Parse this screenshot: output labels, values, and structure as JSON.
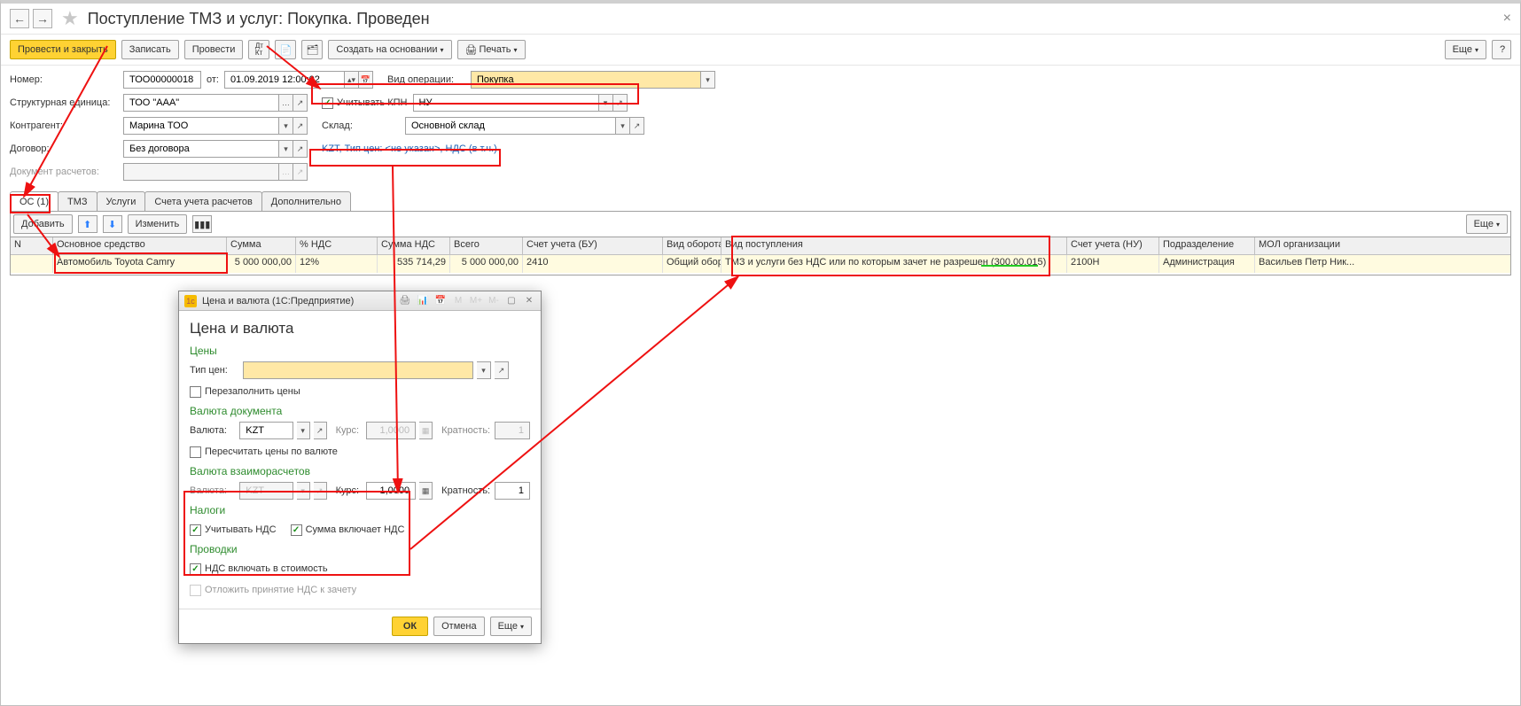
{
  "nav": {
    "back": "←",
    "fwd": "→"
  },
  "title": "Поступление ТМЗ и услуг: Покупка. Проведен",
  "close": "×",
  "toolbar": {
    "post_close": "Провести и закрыть",
    "save": "Записать",
    "post": "Провести",
    "create_based": "Создать на основании",
    "print": "Печать",
    "more": "Еще",
    "help": "?"
  },
  "form": {
    "number_label": "Номер:",
    "number": "ТОО00000018",
    "from_label": "от:",
    "date": "01.09.2019 12:00:02",
    "op_label": "Вид операции:",
    "op_value": "Покупка",
    "struct_label": "Структурная единица:",
    "struct": "ТОО \"ААА\"",
    "kpn_label": "Учитывать КПН",
    "kpn_val": "НУ",
    "counter_label": "Контрагент:",
    "counter": "Марина ТОО",
    "store_label": "Склад:",
    "store": "Основной склад",
    "contract_label": "Договор:",
    "contract": "Без договора",
    "price_link": "KZT, Тип цен: <не указан>, НДС (в т.ч.)",
    "settl_label": "Документ расчетов:"
  },
  "tabs": [
    "ОС (1)",
    "ТМЗ",
    "Услуги",
    "Счета учета расчетов",
    "Дополнительно"
  ],
  "gridbar": {
    "add": "Добавить",
    "edit": "Изменить",
    "more": "Еще"
  },
  "grid": {
    "cols": {
      "n": "N",
      "os": "Основное средство",
      "sum": "Сумма",
      "nds": "% НДС",
      "sumnds": "Сумма НДС",
      "total": "Всего",
      "acc": "Счет учета (БУ)",
      "obor": "Вид оборота",
      "vid": "Вид поступления",
      "accnu": "Счет учета (НУ)",
      "podr": "Подразделение",
      "mol": "МОЛ организации"
    },
    "row": {
      "n": "",
      "os": "Автомобиль Toyota Camry",
      "sum": "5 000 000,00",
      "nds": "12%",
      "sumnds": "535 714,29",
      "total": "5 000 000,00",
      "acc": "2410",
      "obor": "Общий обор...",
      "vid": "ТМЗ и услуги без НДС или по которым зачет не разрешен (300.00.015)",
      "accnu": "2100Н",
      "podr": "Администрация",
      "mol": "Васильев Петр Ник..."
    }
  },
  "popup": {
    "wtitle": "Цена и валюта  (1С:Предприятие)",
    "h1": "Цена и валюта",
    "sec_price": "Цены",
    "type_label": "Тип цен:",
    "type_value": "",
    "refill": "Перезаполнить цены",
    "sec_doc": "Валюта документа",
    "curr_label": "Валюта:",
    "curr": "KZT",
    "rate_label": "Курс:",
    "rate": "1,0000",
    "mult_label": "Кратность:",
    "mult": "1",
    "recalc": "Пересчитать цены по валюте",
    "sec_settl": "Валюта взаиморасчетов",
    "settl_curr": "KZT",
    "settl_rate": "1,0000",
    "settl_mult": "1",
    "sec_tax": "Налоги",
    "chk_nds": "Учитывать НДС",
    "chk_sum": "Сумма включает НДС",
    "sec_post": "Проводки",
    "chk_inc": "НДС включать в стоимость",
    "chk_delay": "Отложить принятие НДС к зачету",
    "ok": "ОК",
    "cancel": "Отмена",
    "more": "Еще"
  }
}
